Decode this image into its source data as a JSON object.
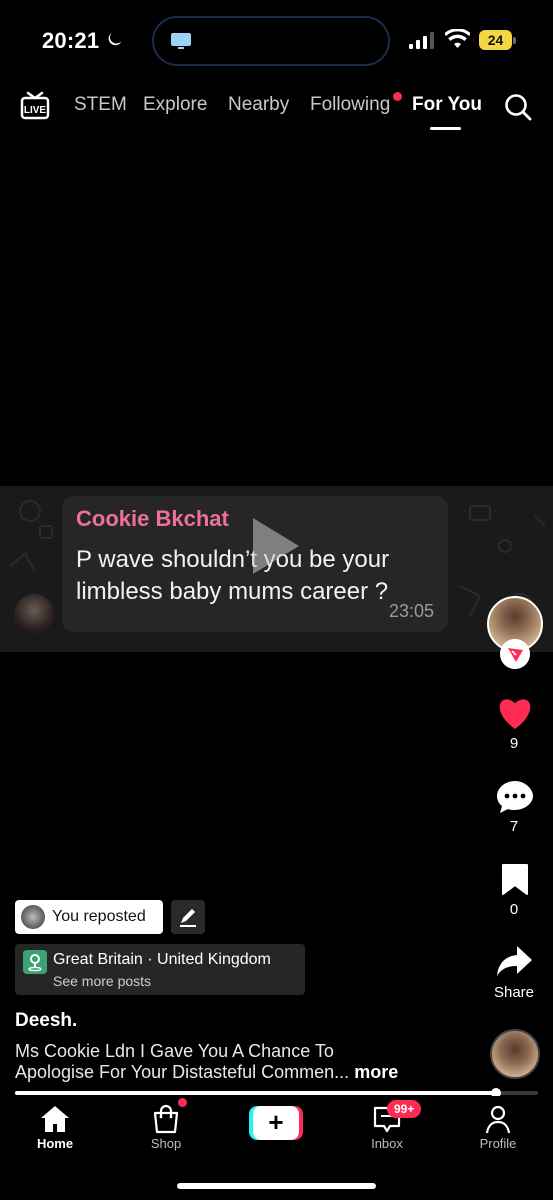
{
  "status_bar": {
    "time": "20:21",
    "battery": "24",
    "icons": [
      "moon-icon",
      "tv-icon",
      "signal-icon",
      "wifi-icon",
      "battery-icon"
    ]
  },
  "top_nav": {
    "live_label": "LIVE",
    "tabs": [
      {
        "label": "STEM"
      },
      {
        "label": "Explore"
      },
      {
        "label": "Nearby"
      },
      {
        "label": "Following"
      },
      {
        "label": "For You"
      }
    ],
    "active_tab": "For You"
  },
  "video": {
    "chat": {
      "sender": "Cookie Bkchat",
      "line1": "P wave shouldn’t you be your",
      "line2": "limbless baby mums career ?",
      "time": "23:05"
    },
    "progress": 0.92
  },
  "actions": {
    "likes": "9",
    "comments": "7",
    "saves": "0",
    "share_label": "Share"
  },
  "post": {
    "repost_label": "You reposted",
    "location_title": "Great Britain · United Kingdom",
    "location_sub": "See more posts",
    "author": "Deesh.",
    "caption_line1": "Ms Cookie Ldn I Gave You A Chance To",
    "caption_line2": "Apologise For Your Distasteful Commen...",
    "caption_more": "more"
  },
  "bottom_nav": {
    "items": [
      {
        "label": "Home"
      },
      {
        "label": "Shop"
      },
      {
        "label": "Inbox"
      },
      {
        "label": "Profile"
      }
    ],
    "inbox_badge": "99+"
  },
  "colors": {
    "accent_red": "#fe2c55",
    "accent_cyan": "#25f4ee",
    "sender_pink": "#ee6f9a",
    "battery_yellow": "#f6d743"
  }
}
